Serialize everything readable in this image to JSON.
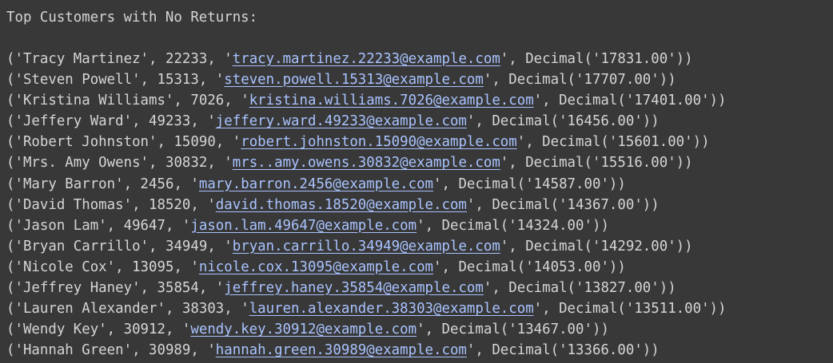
{
  "output": {
    "heading": "Top Customers with No Returns:",
    "rows": [
      {
        "name": "Tracy Martinez",
        "id": "22233",
        "email": "tracy.martinez.22233@example.com",
        "amount": "17831.00"
      },
      {
        "name": "Steven Powell",
        "id": "15313",
        "email": "steven.powell.15313@example.com",
        "amount": "17707.00"
      },
      {
        "name": "Kristina Williams",
        "id": "7026",
        "email": "kristina.williams.7026@example.com",
        "amount": "17401.00"
      },
      {
        "name": "Jeffery Ward",
        "id": "49233",
        "email": "jeffery.ward.49233@example.com",
        "amount": "16456.00"
      },
      {
        "name": "Robert Johnston",
        "id": "15090",
        "email": "robert.johnston.15090@example.com",
        "amount": "15601.00"
      },
      {
        "name": "Mrs. Amy Owens",
        "id": "30832",
        "email": "mrs..amy.owens.30832@example.com",
        "amount": "15516.00"
      },
      {
        "name": "Mary Barron",
        "id": "2456",
        "email": "mary.barron.2456@example.com",
        "amount": "14587.00"
      },
      {
        "name": "David Thomas",
        "id": "18520",
        "email": "david.thomas.18520@example.com",
        "amount": "14367.00"
      },
      {
        "name": "Jason Lam",
        "id": "49647",
        "email": "jason.lam.49647@example.com",
        "amount": "14324.00"
      },
      {
        "name": "Bryan Carrillo",
        "id": "34949",
        "email": "bryan.carrillo.34949@example.com",
        "amount": "14292.00"
      },
      {
        "name": "Nicole Cox",
        "id": "13095",
        "email": "nicole.cox.13095@example.com",
        "amount": "14053.00"
      },
      {
        "name": "Jeffrey Haney",
        "id": "35854",
        "email": "jeffrey.haney.35854@example.com",
        "amount": "13827.00"
      },
      {
        "name": "Lauren Alexander",
        "id": "38303",
        "email": "lauren.alexander.38303@example.com",
        "amount": "13511.00"
      },
      {
        "name": "Wendy Key",
        "id": "30912",
        "email": "wendy.key.30912@example.com",
        "amount": "13467.00"
      },
      {
        "name": "Hannah Green",
        "id": "30989",
        "email": "hannah.green.30989@example.com",
        "amount": "13366.00"
      }
    ]
  },
  "colors": {
    "background": "#383838",
    "text": "#d5d5d5",
    "link": "#a9c3ff"
  }
}
